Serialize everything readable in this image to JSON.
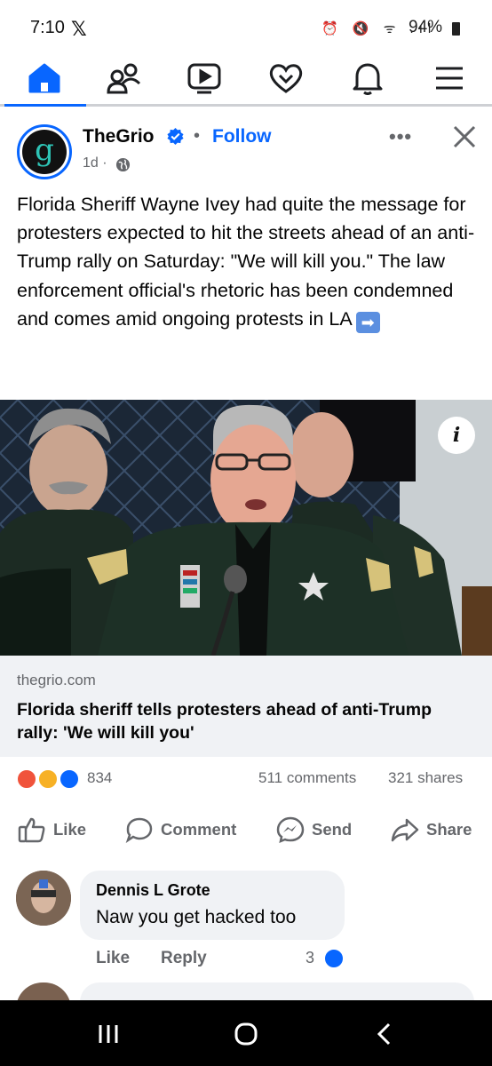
{
  "status_bar": {
    "time": "7:10",
    "x_logo": "𝕏",
    "icons": "⏰ 🔇 ᯤ .ıl",
    "battery": "94%"
  },
  "nav": {
    "items": [
      {
        "name": "home",
        "icon": "home-icon",
        "active": true
      },
      {
        "name": "friends",
        "icon": "friends-icon"
      },
      {
        "name": "video",
        "icon": "video-icon"
      },
      {
        "name": "dating",
        "icon": "heart-icon"
      },
      {
        "name": "notifications",
        "icon": "bell-icon"
      },
      {
        "name": "menu",
        "icon": "hamburger-icon"
      }
    ],
    "accent": "#0866ff"
  },
  "post": {
    "page_name": "TheGrio",
    "avatar_letter": "g",
    "follow": "Follow",
    "separator": "•",
    "time": "1d ·",
    "more": "•••",
    "text": "Florida Sheriff Wayne Ivey had quite the message for protesters expected to hit the streets ahead of an anti-Trump rally on Saturday: \"We will kill you.\" The law enforcement official's rhetoric has been condemned and comes amid ongoing protests in LA",
    "arrow_emoji": "➡"
  },
  "link": {
    "info_label": "i",
    "domain": "thegrio.com",
    "title": "Florida sheriff tells protesters ahead of anti-Trump rally: 'We will kill you'"
  },
  "engagement": {
    "reactions": [
      "angry",
      "wow",
      "like"
    ],
    "reaction_count": "834",
    "comments": "511 comments",
    "shares": "321 shares"
  },
  "actions": {
    "like": "Like",
    "comment": "Comment",
    "send": "Send",
    "share": "Share"
  },
  "comment": {
    "author": "Dennis L Grote",
    "text": "Naw you get hacked too",
    "like": "Like",
    "reply": "Reply",
    "reaction_count": "3"
  }
}
